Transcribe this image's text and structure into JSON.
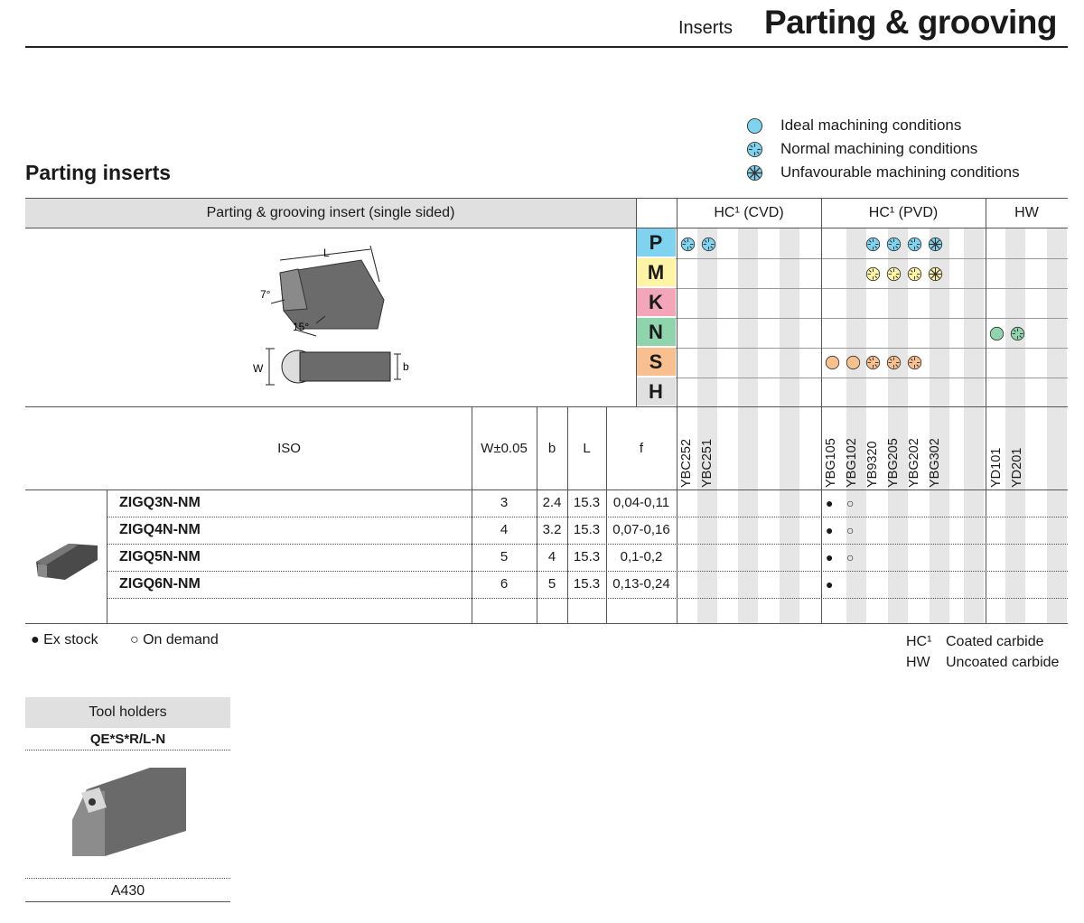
{
  "header": {
    "section": "Inserts",
    "title": "Parting & grooving"
  },
  "legend": {
    "ideal": "Ideal machining conditions",
    "normal": "Normal machining conditions",
    "unfavourable": "Unfavourable machining conditions"
  },
  "section_title": "Parting inserts",
  "table": {
    "title": "Parting & grooving insert (single sided)",
    "groups": [
      {
        "label": "HC¹ (CVD)"
      },
      {
        "label": "HC¹ (PVD)"
      },
      {
        "label": "HW"
      }
    ],
    "materials": [
      "P",
      "M",
      "K",
      "N",
      "S",
      "H"
    ],
    "material_colors": {
      "P": "#7fd3ef",
      "M": "#fff3a6",
      "K": "#f3a6b8",
      "N": "#8fd4ad",
      "S": "#f7c08e",
      "H": "#e0e0e0"
    },
    "drawing_labels": {
      "L": "L",
      "angle7": "7°",
      "angle15": "15°",
      "W": "W",
      "b": "b"
    },
    "columns": {
      "iso": "ISO",
      "w": "W±0.05",
      "b": "b",
      "l": "L",
      "f": "f"
    },
    "grades": [
      "YBC252",
      "YBC251",
      "YBG105",
      "YBG102",
      "YB9320",
      "YBG205",
      "YBG202",
      "YBG302",
      "YD101",
      "YD201"
    ],
    "rows": [
      {
        "iso": "ZIGQ3N-NM",
        "w": "3",
        "b": "2.4",
        "l": "15.3",
        "f": "0,04-0,11",
        "avail": [
          "●",
          "○"
        ]
      },
      {
        "iso": "ZIGQ4N-NM",
        "w": "4",
        "b": "3.2",
        "l": "15.3",
        "f": "0,07-0,16",
        "avail": [
          "●",
          "○"
        ]
      },
      {
        "iso": "ZIGQ5N-NM",
        "w": "5",
        "b": "4",
        "l": "15.3",
        "f": "0,1-0,2",
        "avail": [
          "●",
          "○"
        ]
      },
      {
        "iso": "ZIGQ6N-NM",
        "w": "6",
        "b": "5",
        "l": "15.3",
        "f": "0,13-0,24",
        "avail": [
          "●"
        ]
      }
    ]
  },
  "footnotes": {
    "ex_stock": "● Ex stock",
    "on_demand": "○ On demand",
    "hc_abbr": "HC¹",
    "hc_text": "Coated carbide",
    "hw_abbr": "HW",
    "hw_text": "Uncoated carbide"
  },
  "tool_holders": {
    "title": "Tool holders",
    "model": "QE*S*R/L-N",
    "page": "A430"
  }
}
